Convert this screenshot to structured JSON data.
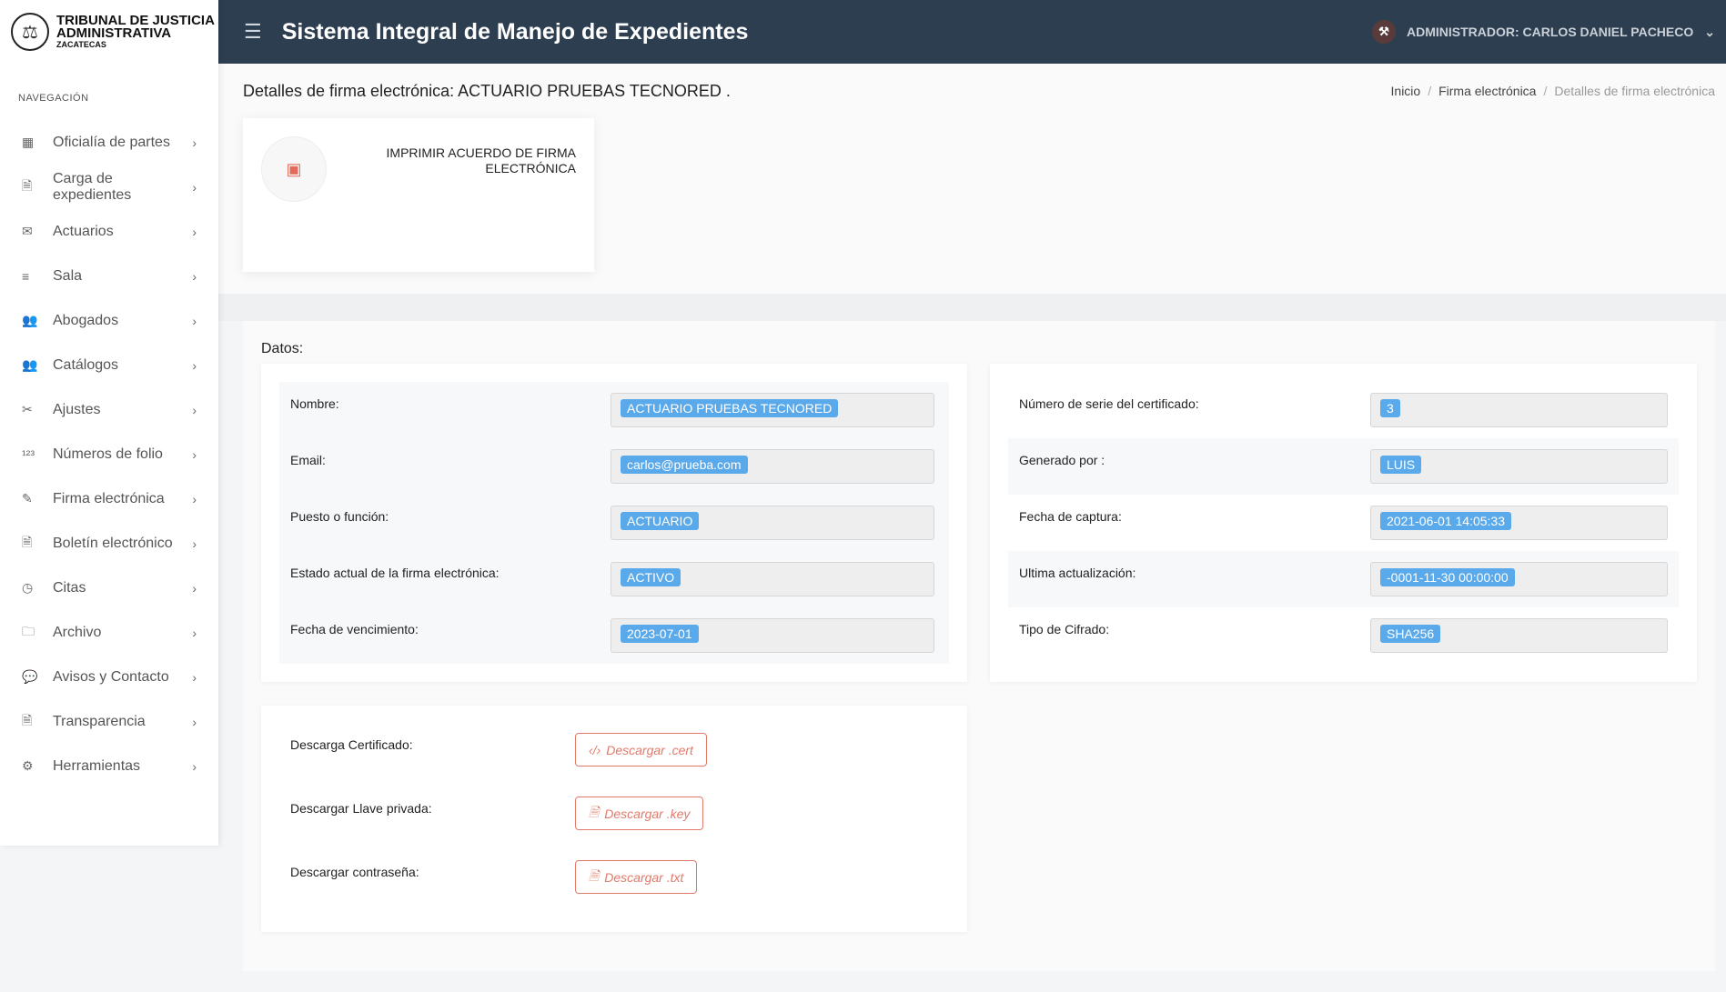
{
  "logo": {
    "line1": "TRIBUNAL DE JUSTICIA",
    "line2": "ADMINISTRATIVA",
    "line3": "ZACATECAS"
  },
  "sidebar": {
    "title": "NAVEGACIÓN",
    "items": [
      {
        "label": "Oficialía de partes",
        "icon": "building-icon"
      },
      {
        "label": "Carga de expedientes",
        "icon": "file-upload-icon"
      },
      {
        "label": "Actuarios",
        "icon": "mail-icon"
      },
      {
        "label": "Sala",
        "icon": "list-icon"
      },
      {
        "label": "Abogados",
        "icon": "users-icon"
      },
      {
        "label": "Catálogos",
        "icon": "group-icon"
      },
      {
        "label": "Ajustes",
        "icon": "tools-icon"
      },
      {
        "label": "Números de folio",
        "icon": "numbers-icon"
      },
      {
        "label": "Firma electrónica",
        "icon": "pen-icon"
      },
      {
        "label": "Boletín electrónico",
        "icon": "document-icon"
      },
      {
        "label": "Citas",
        "icon": "clock-icon"
      },
      {
        "label": "Archivo",
        "icon": "folder-icon"
      },
      {
        "label": "Avisos y Contacto",
        "icon": "chat-icon"
      },
      {
        "label": "Transparencia",
        "icon": "file-icon"
      },
      {
        "label": "Herramientas",
        "icon": "gear-icon"
      }
    ]
  },
  "header": {
    "title": "Sistema Integral de Manejo de Expedientes",
    "user": "ADMINISTRADOR: CARLOS DANIEL PACHECO"
  },
  "page": {
    "title": "Detalles de firma electrónica: ACTUARIO PRUEBAS TECNORED .",
    "breadcrumb": [
      "Inicio",
      "Firma electrónica",
      "Detalles de firma electrónica"
    ]
  },
  "print": {
    "label": "IMPRIMIR ACUERDO DE FIRMA ELECTRÓNICA"
  },
  "datos": {
    "title": "Datos:",
    "left": [
      {
        "label": "Nombre:",
        "value": "ACTUARIO PRUEBAS TECNORED"
      },
      {
        "label": "Email:",
        "value": "carlos@prueba.com"
      },
      {
        "label": "Puesto o función:",
        "value": "ACTUARIO"
      },
      {
        "label": "Estado actual de la firma electrónica:",
        "value": "ACTIVO"
      },
      {
        "label": "Fecha de vencimiento:",
        "value": "2023-07-01"
      }
    ],
    "right": [
      {
        "label": "Número de serie del certificado:",
        "value": "3"
      },
      {
        "label": "Generado por :",
        "value": "LUIS"
      },
      {
        "label": "Fecha de captura:",
        "value": "2021-06-01 14:05:33"
      },
      {
        "label": "Ultima actualización:",
        "value": "-0001-11-30 00:00:00"
      },
      {
        "label": "Tipo de Cifrado:",
        "value": "SHA256"
      }
    ]
  },
  "downloads": [
    {
      "label": "Descarga Certificado:",
      "button": "Descargar .cert",
      "icon": "code-icon"
    },
    {
      "label": "Descargar Llave privada:",
      "button": "Descargar .key",
      "icon": "pdf-file-icon"
    },
    {
      "label": "Descargar contraseña:",
      "button": "Descargar .txt",
      "icon": "pdf-file-icon"
    }
  ],
  "colors": {
    "header": "#2d3e50",
    "badge": "#5aa9ea",
    "accent": "#e07a6a"
  }
}
